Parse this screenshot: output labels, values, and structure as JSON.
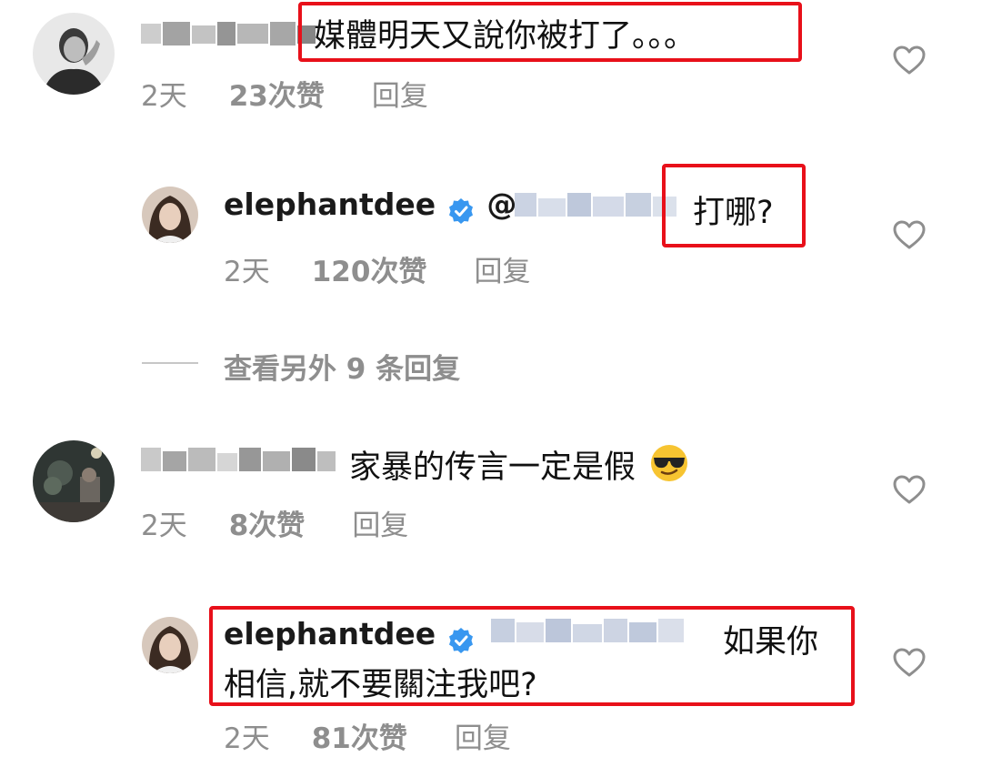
{
  "comment1": {
    "text": "媒體明天又說你被打了。。。",
    "time": "2天",
    "likes": "23次赞",
    "reply": "回复"
  },
  "reply1": {
    "username": "elephantdee",
    "mention": "@",
    "text": "打哪?",
    "time": "2天",
    "likes": "120次赞",
    "reply": "回复"
  },
  "view_more": {
    "label": "查看另外 9 条回复"
  },
  "comment2": {
    "text": "家暴的传言一定是假",
    "emoji": "😎",
    "time": "2天",
    "likes": "8次赞",
    "reply": "回复"
  },
  "reply2": {
    "username": "elephantdee",
    "text_line1": "如果你",
    "text_line2": "相信,就不要關注我吧?",
    "time": "2天",
    "likes": "81次赞",
    "reply": "回复"
  },
  "colors": {
    "highlight": "#e8101a",
    "verified": "#3897f0",
    "muted": "#8e8e8e"
  }
}
